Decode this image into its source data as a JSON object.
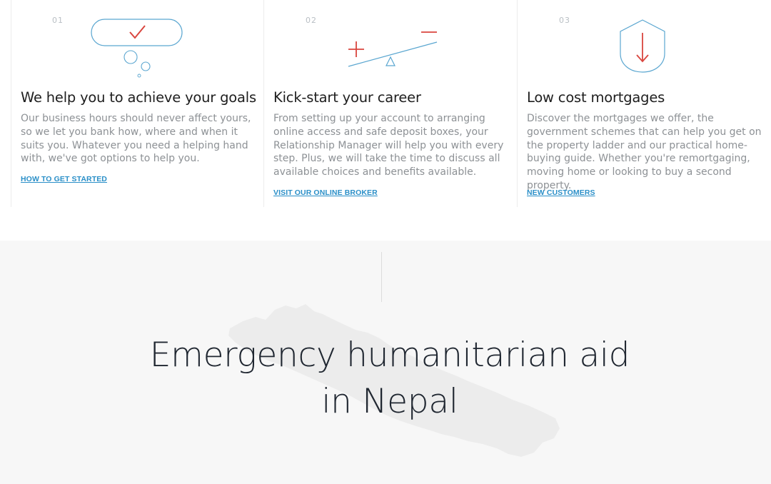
{
  "features": [
    {
      "number": "01",
      "icon": "thought-bubble-check-icon",
      "title": "We help you to achieve your goals",
      "description": "Our business hours should never affect yours, so we let you bank how, where and when it suits you. Whatever you need a helping hand with, we've got options to help you.",
      "link": "HOW TO GET STARTED"
    },
    {
      "number": "02",
      "icon": "balance-seesaw-icon",
      "title": "Kick-start your career",
      "description": "From setting up your account to arranging online access and safe deposit boxes, your Relationship Manager will help you with every step. Plus, we will take the time to discuss all available choices and benefits available.",
      "link": "VISIT OUR ONLINE BROKER"
    },
    {
      "number": "03",
      "icon": "shield-down-arrow-icon",
      "title": "Low cost mortgages",
      "description": "Discover the mortgages we offer, the government schemes that can help you get on the property ladder and our practical home-buying guide. Whether you're remortgaging, moving home or looking to buy a second property.",
      "link": "NEW CUSTOMERS"
    }
  ],
  "nepal_section": {
    "headline_line1": "Emergency humanitarian aid",
    "headline_line2": "in Nepal",
    "background_icon": "nepal-map-icon"
  },
  "colors": {
    "accent_red": "#d9453e",
    "accent_blue": "#5aa6d0",
    "link": "#2a8fc8",
    "section_bg": "#f7f7f7"
  }
}
